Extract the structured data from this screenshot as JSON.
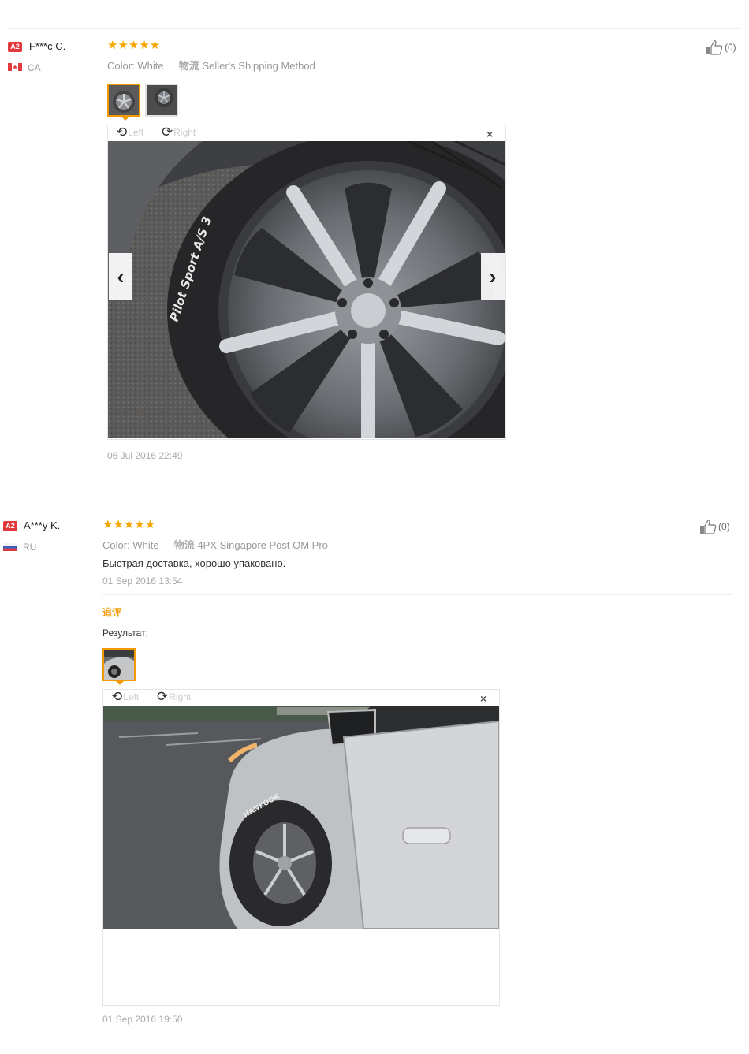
{
  "reviews": [
    {
      "badge": "A2",
      "user": "F***c C.",
      "country": "CA",
      "stars": "★★★★★",
      "color_label": "Color:",
      "color_value": "White",
      "logistics_icon": "物流",
      "shipping": "Seller's Shipping Method",
      "likes": "(0)",
      "viewer_left": "Left",
      "viewer_right": "Right",
      "close": "×",
      "date": "06 Jul 2016 22:49"
    },
    {
      "badge": "A2",
      "user": "A***y K.",
      "country": "RU",
      "stars": "★★★★★",
      "color_label": "Color:",
      "color_value": "White",
      "logistics_icon": "物流",
      "shipping": "4PX Singapore Post OM Pro",
      "likes": "(0)",
      "text": "Быстрая доставка, хорошо упаковано.",
      "date": "01 Sep 2016 13:54",
      "followup_label": "追评",
      "result_label": "Результат:",
      "viewer_left": "Left",
      "viewer_right": "Right",
      "close": "×",
      "followup_date": "01 Sep 2016 19:50"
    }
  ],
  "icons": {
    "prev": "‹",
    "next": "›",
    "thumb_up": "thumbs-up-icon"
  },
  "colors": {
    "star": "#f7a600",
    "badge": "#e4393c",
    "accent": "#f39800"
  }
}
